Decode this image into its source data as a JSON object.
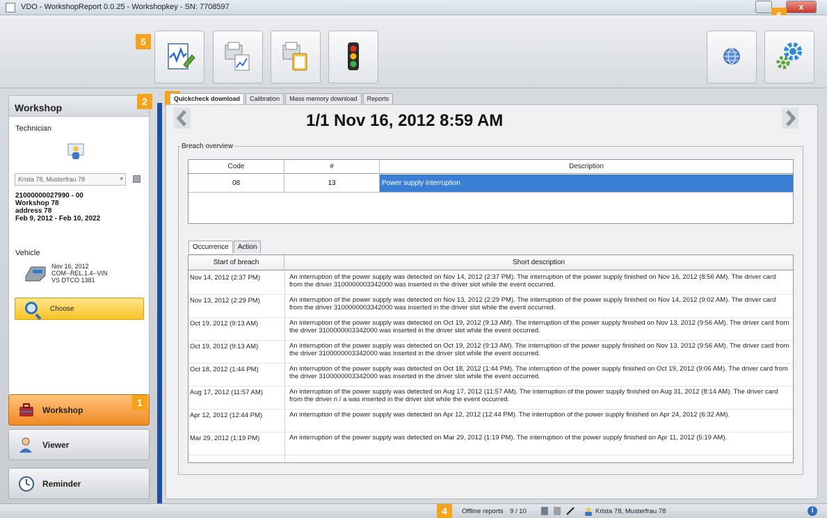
{
  "window": {
    "title": "VDO - WorkshopReport 0.0.25 - Workshopkey - SN: 7708597",
    "close_label": "x"
  },
  "badges": {
    "b1": "1",
    "b2": "2",
    "b3": "3",
    "b4": "4",
    "b5": "5",
    "b6": "6"
  },
  "toolbar": {
    "buttons": [
      {
        "icon": "report-edit-icon"
      },
      {
        "icon": "printer-chart-icon"
      },
      {
        "icon": "printer-clipboard-icon"
      },
      {
        "icon": "traffic-light-icon"
      },
      {
        "icon": "globe-icon"
      },
      {
        "icon": "settings-gears-icon"
      }
    ]
  },
  "workshop_card": {
    "header": "Workshop",
    "technician_label": "Technician",
    "technician_select": "Krista 78, Musterfrau 78",
    "workshop_lines": [
      "21000000027990 - 00",
      "Workshop 78",
      "address 78",
      "Feb 9, 2012 - Feb 10, 2022"
    ],
    "vehicle_label": "Vehicle",
    "vehicle_lines": [
      "Nov 16, 2012",
      "COM--REL.1.4--VIN",
      "VS DTCO 1381"
    ],
    "choose_label": "Choose"
  },
  "nav": {
    "workshop": "Workshop",
    "viewer": "Viewer",
    "reminder": "Reminder"
  },
  "tabs": [
    "Quickcheck download",
    "Calibration",
    "Mass memory download",
    "Reports"
  ],
  "header_date": "1/1 Nov 16, 2012 8:59 AM",
  "breach_overview": {
    "label": "Breach overview",
    "columns": [
      "Code",
      "#",
      "Description"
    ],
    "rows": [
      {
        "code": "08",
        "count": "13",
        "description": "Power supply interruption"
      }
    ]
  },
  "occurrence": {
    "tabs": [
      "Occurrence",
      "Action"
    ],
    "columns": [
      "Start of breach",
      "Short description"
    ],
    "rows": [
      {
        "start": "Nov 14, 2012 (2:37 PM)",
        "desc": "An interruption of the power supply was detected on Nov 14, 2012 (2:37 PM). The interruption of the power supply finished on Nov 16, 2012 (8:56 AM). The driver card from the driver 3100000003342000 was inserted in the driver slot while the event occurred."
      },
      {
        "start": "Nov 13, 2012 (2:29 PM)",
        "desc": "An interruption of the power supply was detected on Nov 13, 2012 (2:29 PM). The interruption of the power supply finished on Nov 14, 2012 (9:02 AM). The driver card from the driver 3100000003342000 was inserted in the driver slot while the event occurred."
      },
      {
        "start": "Oct 19, 2012 (9:13 AM)",
        "desc": "An interruption of the power supply was detected on Oct 19, 2012 (9:13 AM). The interruption of the power supply finished on Nov 13, 2012 (9:56 AM). The driver card from the driver 3100000003342000 was inserted in the driver slot while the event occurred."
      },
      {
        "start": "Oct 19, 2012 (9:13 AM)",
        "desc": "An interruption of the power supply was detected on Oct 19, 2012 (9:13 AM). The interruption of the power supply finished on Nov 13, 2012 (9:56 AM). The driver card from the driver 3100000003342000 was inserted in the driver slot while the event occurred."
      },
      {
        "start": "Oct 18, 2012 (1:44 PM)",
        "desc": "An interruption of the power supply was detected on Oct 18, 2012 (1:44 PM). The interruption of the power supply finished on Oct 19, 2012 (9:06 AM). The driver card from the driver 3100000003342000 was inserted in the driver slot while the event occurred."
      },
      {
        "start": "Aug 17, 2012 (11:57 AM)",
        "desc": "An interruption of the power supply was detected on Aug 17, 2012 (11:57 AM). The interruption of the power supply finished on Aug 31, 2012 (8:14 AM). The driver card from the driver n / a was inserted in the driver slot while the event occurred."
      },
      {
        "start": "Apr 12, 2012 (12:44 PM)",
        "desc": "An interruption of the power supply was detected on Apr 12, 2012 (12:44 PM). The interruption of the power supply finished on Apr 24, 2012 (6:32 AM)."
      },
      {
        "start": "Mar 29, 2012 (1:19 PM)",
        "desc": "An interruption of the power supply was detected on Mar 29, 2012 (1:19 PM). The interruption of the power supply finished on Apr 11, 2012 (5:19 AM)."
      }
    ]
  },
  "statusbar": {
    "offline_label": "Offline reports",
    "offline_count": "9 / 10",
    "user": "Krista 78, Musterfrau 78",
    "info": "i"
  },
  "colors": {
    "accent": "#f7a21b",
    "selection": "#3b7fd4",
    "sidebar_bar": "#1f4ea0",
    "active_nav": "#f08a25"
  }
}
